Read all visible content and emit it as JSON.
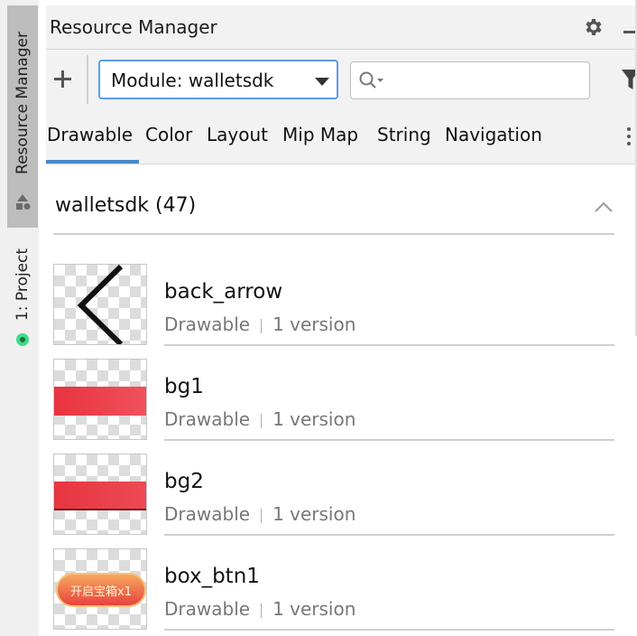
{
  "sidebar": {
    "resource_manager_tab": "Resource Manager",
    "project_tab": "1: Project"
  },
  "header": {
    "title": "Resource Manager"
  },
  "toolbar": {
    "module_select": "Module: walletsdk",
    "search_placeholder": ""
  },
  "tabs": [
    {
      "label": "Drawable",
      "selected": true
    },
    {
      "label": "Color"
    },
    {
      "label": "Layout"
    },
    {
      "label": "Mip Map"
    },
    {
      "label": "String"
    },
    {
      "label": "Navigation"
    }
  ],
  "group": {
    "title": "walletsdk (47)"
  },
  "resources": [
    {
      "name": "back_arrow",
      "type": "Drawable",
      "versions": "1 version"
    },
    {
      "name": "bg1",
      "type": "Drawable",
      "versions": "1 version"
    },
    {
      "name": "bg2",
      "type": "Drawable",
      "versions": "1 version"
    },
    {
      "name": "box_btn1",
      "type": "Drawable",
      "versions": "1 version",
      "preview_text": "开启宝箱x1"
    }
  ],
  "colors": {
    "accent": "#4a88c7",
    "focus": "#589df6",
    "preview_red": "#ea3a45"
  }
}
